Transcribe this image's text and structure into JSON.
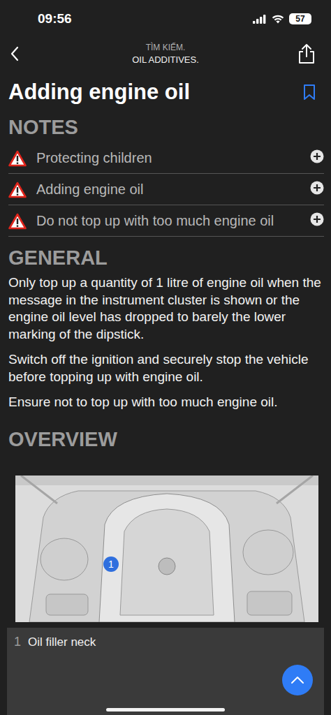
{
  "status_bar": {
    "time": "09:56",
    "battery": "57",
    "signal_level": 4
  },
  "header": {
    "breadcrumb": "TÌM KIẾM.",
    "subtitle": "OIL ADDITIVES."
  },
  "page": {
    "title": "Adding engine oil",
    "bookmarked": false
  },
  "notes": {
    "heading": "NOTES",
    "items": [
      {
        "label": "Protecting children",
        "expanded": false
      },
      {
        "label": "Adding engine oil",
        "expanded": false
      },
      {
        "label": "Do not top up with too much engine oil",
        "expanded": false
      }
    ]
  },
  "general": {
    "heading": "GENERAL",
    "paragraphs": [
      "Only top up a quantity of 1 litre of engine oil when the message in the instrument cluster is shown or the engine oil level has dropped to barely the lower marking of the dipstick.",
      "Switch off the ignition and securely stop the vehicle before topping up with engine oil.",
      "Ensure not to top up with too much engine oil."
    ]
  },
  "overview": {
    "heading": "OVERVIEW",
    "markers": [
      {
        "label": "1"
      }
    ],
    "legend": [
      {
        "number": "1",
        "text": "Oil filler neck"
      }
    ]
  }
}
